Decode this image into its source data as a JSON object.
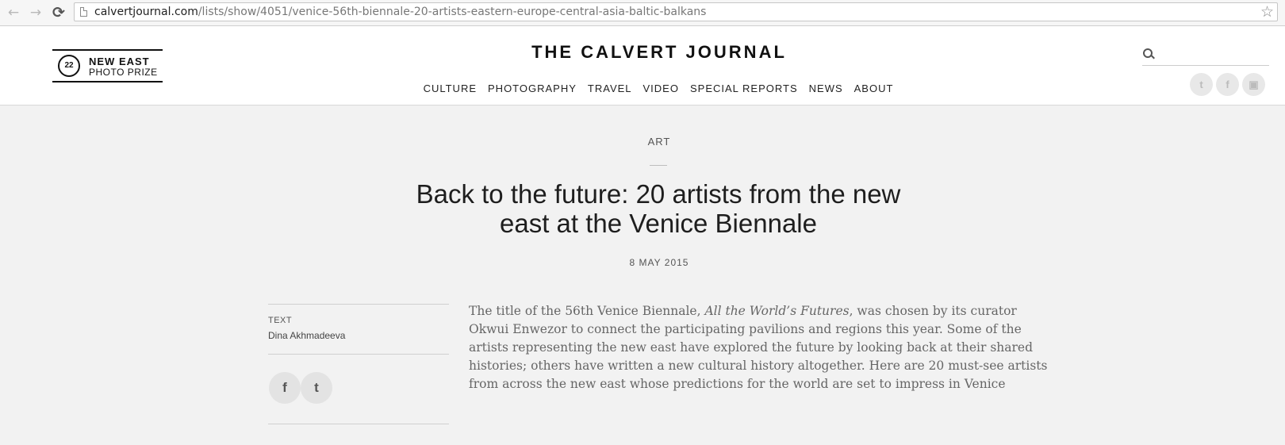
{
  "browser": {
    "url_host": "calvertjournal.com",
    "url_path": "/lists/show/4051/venice-56th-biennale-20-artists-eastern-europe-central-asia-baltic-balkans",
    "back_icon": "←",
    "forward_icon": "→",
    "reload_icon": "⟳",
    "star_icon": "☆"
  },
  "header": {
    "promo": {
      "badge": "22",
      "line1": "NEW EAST",
      "line2": "PHOTO PRIZE"
    },
    "logo": "THE CALVERT JOURNAL",
    "nav": [
      "CULTURE",
      "PHOTOGRAPHY",
      "TRAVEL",
      "VIDEO",
      "SPECIAL REPORTS",
      "NEWS",
      "ABOUT"
    ],
    "social": {
      "twitter_glyph": "t",
      "facebook_glyph": "f",
      "instagram_glyph": "▣"
    }
  },
  "article": {
    "category": "ART",
    "title": "Back to the future: 20 artists from the new east at the Venice Biennale",
    "date": "8 MAY 2015",
    "credit_label": "TEXT",
    "credit_name": "Dina Akhmadeeva",
    "share": {
      "facebook_glyph": "f",
      "twitter_glyph": "t"
    },
    "lede_before": "The title of the 56th Venice Biennale, ",
    "lede_italic": "All the World’s Futures",
    "lede_after": ", was chosen by its curator Okwui Enwezor to connect the participating pavilions and regions this year. Some of the artists representing the new east have explored the future by looking back at their shared histories; others have written a new cultural history altogether. Here are 20 must-see artists from across the new east whose predictions for the world are set to impress in Venice"
  },
  "colors": {
    "page_background": "#f2f2f2",
    "header_background": "#ffffff",
    "text_dark": "#1e1e1e",
    "text_muted": "#666666"
  }
}
